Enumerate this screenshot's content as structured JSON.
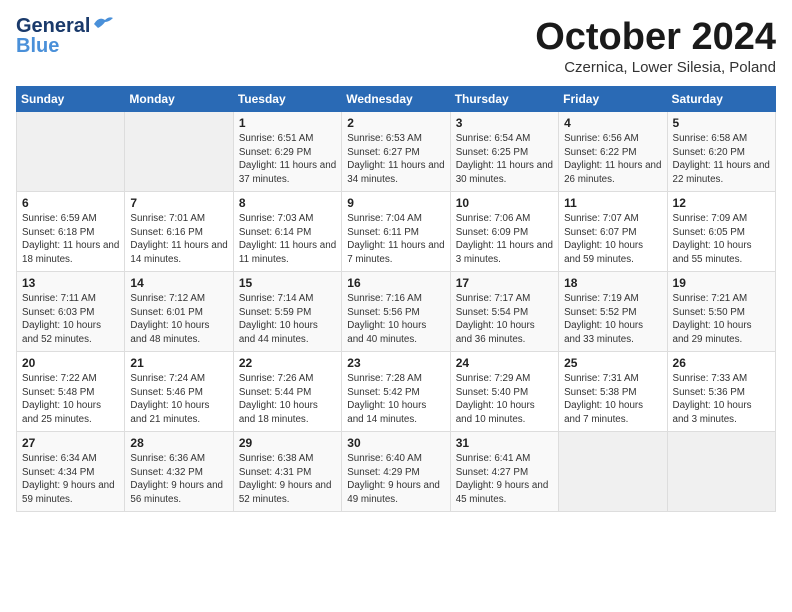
{
  "logo": {
    "general": "General",
    "blue": "Blue"
  },
  "title": "October 2024",
  "subtitle": "Czernica, Lower Silesia, Poland",
  "days_of_week": [
    "Sunday",
    "Monday",
    "Tuesday",
    "Wednesday",
    "Thursday",
    "Friday",
    "Saturday"
  ],
  "weeks": [
    [
      {
        "day": "",
        "info": ""
      },
      {
        "day": "",
        "info": ""
      },
      {
        "day": "1",
        "info": "Sunrise: 6:51 AM\nSunset: 6:29 PM\nDaylight: 11 hours and 37 minutes."
      },
      {
        "day": "2",
        "info": "Sunrise: 6:53 AM\nSunset: 6:27 PM\nDaylight: 11 hours and 34 minutes."
      },
      {
        "day": "3",
        "info": "Sunrise: 6:54 AM\nSunset: 6:25 PM\nDaylight: 11 hours and 30 minutes."
      },
      {
        "day": "4",
        "info": "Sunrise: 6:56 AM\nSunset: 6:22 PM\nDaylight: 11 hours and 26 minutes."
      },
      {
        "day": "5",
        "info": "Sunrise: 6:58 AM\nSunset: 6:20 PM\nDaylight: 11 hours and 22 minutes."
      }
    ],
    [
      {
        "day": "6",
        "info": "Sunrise: 6:59 AM\nSunset: 6:18 PM\nDaylight: 11 hours and 18 minutes."
      },
      {
        "day": "7",
        "info": "Sunrise: 7:01 AM\nSunset: 6:16 PM\nDaylight: 11 hours and 14 minutes."
      },
      {
        "day": "8",
        "info": "Sunrise: 7:03 AM\nSunset: 6:14 PM\nDaylight: 11 hours and 11 minutes."
      },
      {
        "day": "9",
        "info": "Sunrise: 7:04 AM\nSunset: 6:11 PM\nDaylight: 11 hours and 7 minutes."
      },
      {
        "day": "10",
        "info": "Sunrise: 7:06 AM\nSunset: 6:09 PM\nDaylight: 11 hours and 3 minutes."
      },
      {
        "day": "11",
        "info": "Sunrise: 7:07 AM\nSunset: 6:07 PM\nDaylight: 10 hours and 59 minutes."
      },
      {
        "day": "12",
        "info": "Sunrise: 7:09 AM\nSunset: 6:05 PM\nDaylight: 10 hours and 55 minutes."
      }
    ],
    [
      {
        "day": "13",
        "info": "Sunrise: 7:11 AM\nSunset: 6:03 PM\nDaylight: 10 hours and 52 minutes."
      },
      {
        "day": "14",
        "info": "Sunrise: 7:12 AM\nSunset: 6:01 PM\nDaylight: 10 hours and 48 minutes."
      },
      {
        "day": "15",
        "info": "Sunrise: 7:14 AM\nSunset: 5:59 PM\nDaylight: 10 hours and 44 minutes."
      },
      {
        "day": "16",
        "info": "Sunrise: 7:16 AM\nSunset: 5:56 PM\nDaylight: 10 hours and 40 minutes."
      },
      {
        "day": "17",
        "info": "Sunrise: 7:17 AM\nSunset: 5:54 PM\nDaylight: 10 hours and 36 minutes."
      },
      {
        "day": "18",
        "info": "Sunrise: 7:19 AM\nSunset: 5:52 PM\nDaylight: 10 hours and 33 minutes."
      },
      {
        "day": "19",
        "info": "Sunrise: 7:21 AM\nSunset: 5:50 PM\nDaylight: 10 hours and 29 minutes."
      }
    ],
    [
      {
        "day": "20",
        "info": "Sunrise: 7:22 AM\nSunset: 5:48 PM\nDaylight: 10 hours and 25 minutes."
      },
      {
        "day": "21",
        "info": "Sunrise: 7:24 AM\nSunset: 5:46 PM\nDaylight: 10 hours and 21 minutes."
      },
      {
        "day": "22",
        "info": "Sunrise: 7:26 AM\nSunset: 5:44 PM\nDaylight: 10 hours and 18 minutes."
      },
      {
        "day": "23",
        "info": "Sunrise: 7:28 AM\nSunset: 5:42 PM\nDaylight: 10 hours and 14 minutes."
      },
      {
        "day": "24",
        "info": "Sunrise: 7:29 AM\nSunset: 5:40 PM\nDaylight: 10 hours and 10 minutes."
      },
      {
        "day": "25",
        "info": "Sunrise: 7:31 AM\nSunset: 5:38 PM\nDaylight: 10 hours and 7 minutes."
      },
      {
        "day": "26",
        "info": "Sunrise: 7:33 AM\nSunset: 5:36 PM\nDaylight: 10 hours and 3 minutes."
      }
    ],
    [
      {
        "day": "27",
        "info": "Sunrise: 6:34 AM\nSunset: 4:34 PM\nDaylight: 9 hours and 59 minutes."
      },
      {
        "day": "28",
        "info": "Sunrise: 6:36 AM\nSunset: 4:32 PM\nDaylight: 9 hours and 56 minutes."
      },
      {
        "day": "29",
        "info": "Sunrise: 6:38 AM\nSunset: 4:31 PM\nDaylight: 9 hours and 52 minutes."
      },
      {
        "day": "30",
        "info": "Sunrise: 6:40 AM\nSunset: 4:29 PM\nDaylight: 9 hours and 49 minutes."
      },
      {
        "day": "31",
        "info": "Sunrise: 6:41 AM\nSunset: 4:27 PM\nDaylight: 9 hours and 45 minutes."
      },
      {
        "day": "",
        "info": ""
      },
      {
        "day": "",
        "info": ""
      }
    ]
  ]
}
